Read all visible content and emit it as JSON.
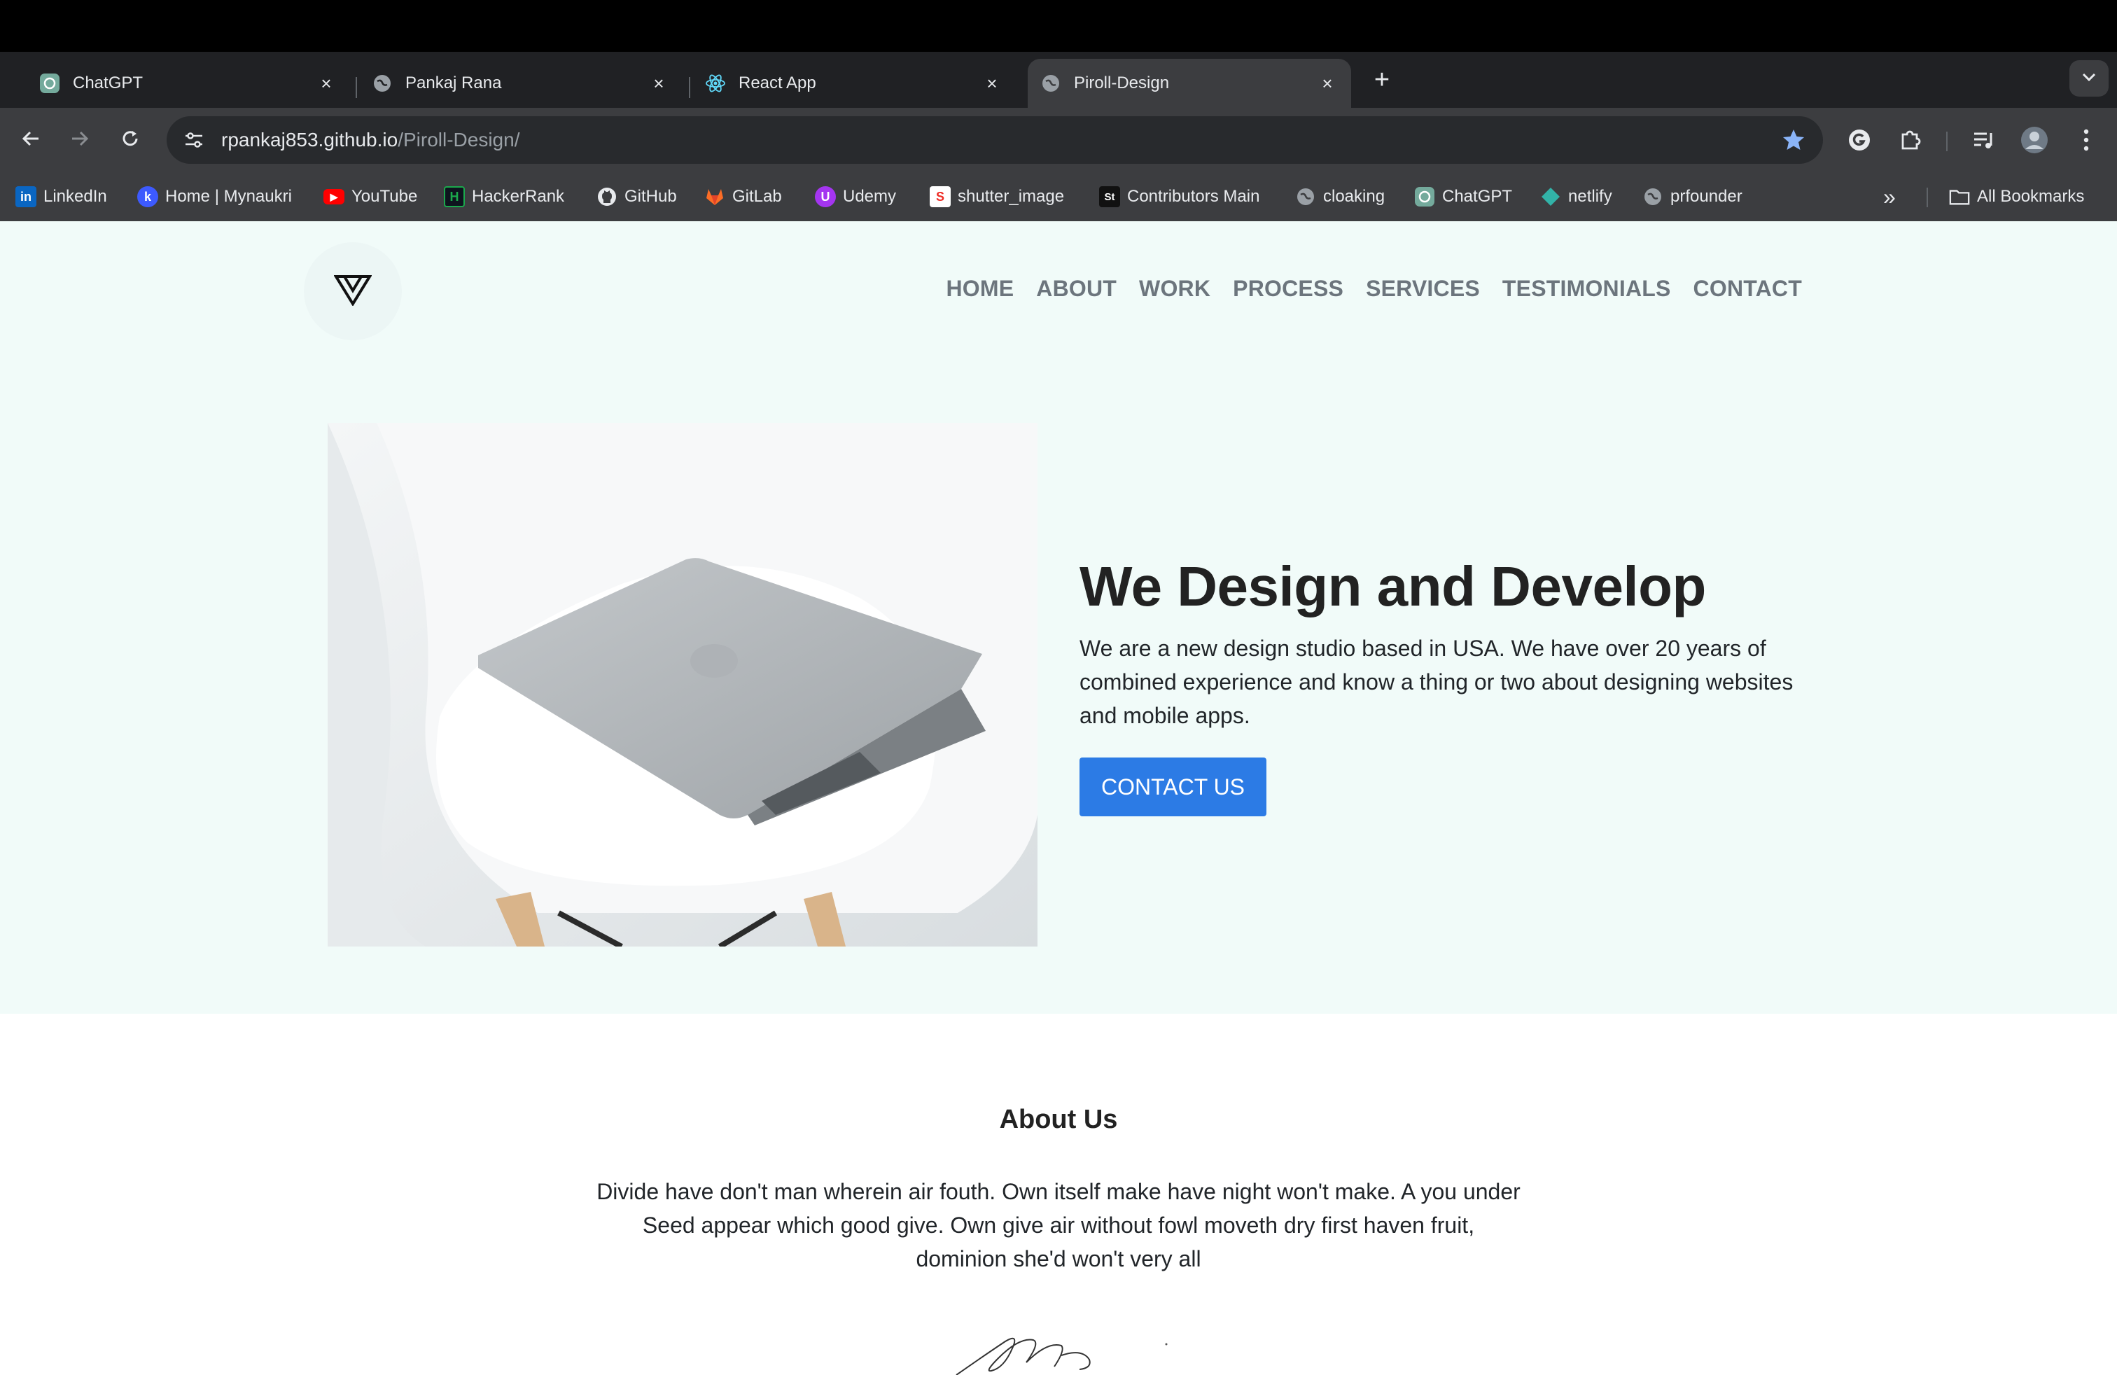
{
  "browser": {
    "tabs": [
      {
        "title": "ChatGPT",
        "icon": "chatgpt-icon"
      },
      {
        "title": "Pankaj Rana",
        "icon": "globe-icon"
      },
      {
        "title": "React App",
        "icon": "react-icon"
      },
      {
        "title": "Piroll-Design",
        "icon": "globe-icon",
        "active": true
      }
    ],
    "close_glyph": "×",
    "new_tab_glyph": "+",
    "url_host": "rpankaj853.github.io",
    "url_path": "/Piroll-Design/",
    "bookmarks": [
      {
        "label": "LinkedIn",
        "icon": "linkedin-icon",
        "glyph": "in",
        "color": "#0a66c2"
      },
      {
        "label": "Home | Mynaukri",
        "icon": "mynaukri-icon",
        "glyph": "k",
        "color": "#3d5afe"
      },
      {
        "label": "YouTube",
        "icon": "youtube-icon",
        "glyph": "▶",
        "color": "#ff0000"
      },
      {
        "label": "HackerRank",
        "icon": "hackerrank-icon",
        "glyph": "H",
        "color": "#1ba94c"
      },
      {
        "label": "GitHub",
        "icon": "github-icon",
        "glyph": "",
        "color": "#ffffff"
      },
      {
        "label": "GitLab",
        "icon": "gitlab-icon",
        "glyph": "",
        "color": "#fc6d26"
      },
      {
        "label": "Udemy",
        "icon": "udemy-icon",
        "glyph": "U",
        "color": "#a435f0"
      },
      {
        "label": "shutter_image",
        "icon": "shutterstock-icon",
        "glyph": "S",
        "color": "#ee2b24"
      },
      {
        "label": "Contributors Main",
        "icon": "contributors-icon",
        "glyph": "St",
        "color": "#111111"
      },
      {
        "label": "cloaking",
        "icon": "globe-icon",
        "glyph": "",
        "color": "#9aa0a6"
      },
      {
        "label": "ChatGPT",
        "icon": "chatgpt-icon",
        "glyph": "",
        "color": "#74aa9c"
      },
      {
        "label": "netlify",
        "icon": "netlify-icon",
        "glyph": "",
        "color": "#32b3a8"
      },
      {
        "label": "prfounder",
        "icon": "globe-icon",
        "glyph": "",
        "color": "#9aa0a6"
      }
    ],
    "more_bookmarks_glyph": "»",
    "all_bookmarks_label": "All Bookmarks"
  },
  "site": {
    "nav": [
      "HOME",
      "ABOUT",
      "WORK",
      "PROCESS",
      "SERVICES",
      "TESTIMONIALS",
      "CONTACT"
    ],
    "hero": {
      "title": "We Design and Develop",
      "description": "We are a new design studio based in USA. We have over 20 years of combined experience and know a thing or two about designing websites and mobile apps.",
      "button": "CONTACT US"
    },
    "about": {
      "title": "About Us",
      "text": "Divide have don't man wherein air fouth. Own itself make have night won't make. A you under Seed appear which good give. Own give air without fowl moveth dry first haven fruit, dominion she'd won't very all"
    }
  },
  "colors": {
    "accent": "#2c7be5",
    "hero_bg": "#f1fbf9",
    "nav_text": "#6c757d",
    "bookmark_star": "#8ab4f8"
  }
}
